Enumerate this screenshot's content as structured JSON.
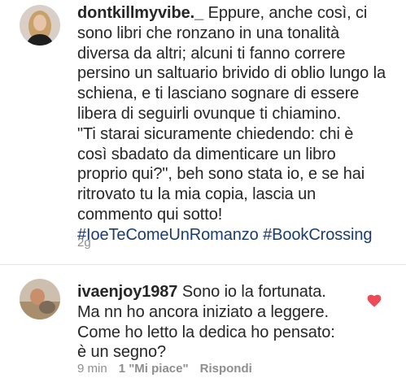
{
  "comment1": {
    "username": "dontkillmyvibe._",
    "body": "Eppure, anche così, ci sono libri che ronzano in una tonalità diversa da altri; alcuni ti fanno correre persino un saltuario brivido di oblio lungo la schiena, e ti lasciano sognare di essere libera di seguirli ovunque ti chiamino.\n\"Ti starai sicuramente chiedendo: chi è così sbadato da dimenticare un libro proprio qui?\", beh sono stata io, e se hai ritrovato tu la mia copia, lascia un commento qui sotto!",
    "hashtags": "#IoeTeComeUnRomanzo #BookCrossing",
    "time": "2g"
  },
  "comment2": {
    "username": "ivaenjoy1987",
    "body": "Sono io la fortunata. Ma nn ho ancora iniziato a leggere. Come ho letto la dedica ho pensato: è un segno?",
    "time": "9 min",
    "likes": "1 \"Mi piace\"",
    "reply": "Rispondi"
  },
  "colors": {
    "hashtag": "#1a3d6e",
    "heart": "#ed4956",
    "meta": "#8e8e8e"
  }
}
